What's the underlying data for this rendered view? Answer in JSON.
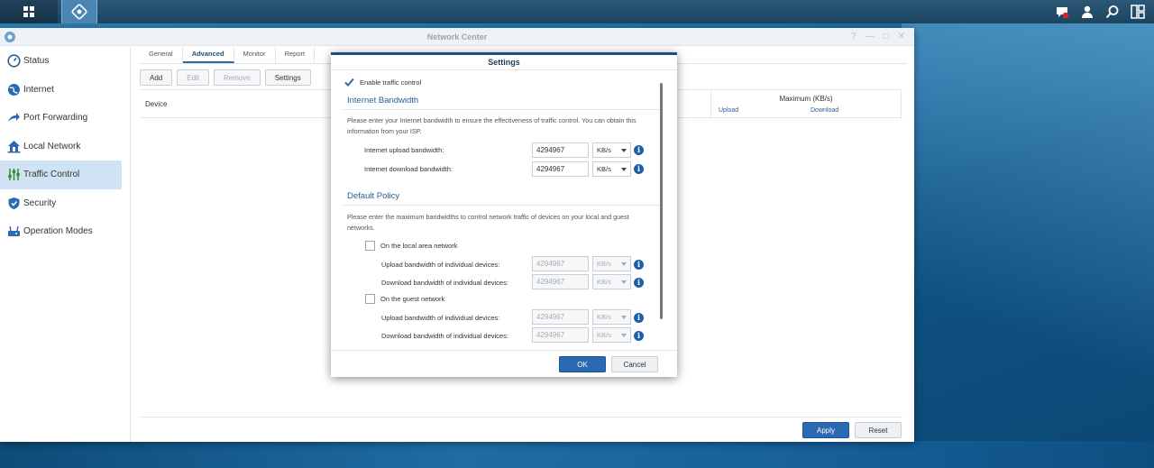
{
  "window": {
    "title": "Network Center"
  },
  "sidebar": {
    "items": [
      {
        "label": "Status",
        "icon": "status-icon"
      },
      {
        "label": "Internet",
        "icon": "globe-icon"
      },
      {
        "label": "Port Forwarding",
        "icon": "arrow-icon"
      },
      {
        "label": "Local Network",
        "icon": "home-icon"
      },
      {
        "label": "Traffic Control",
        "icon": "sliders-icon",
        "active": true
      },
      {
        "label": "Security",
        "icon": "shield-icon"
      },
      {
        "label": "Operation Modes",
        "icon": "modes-icon"
      }
    ]
  },
  "tabs": [
    "General",
    "Advanced",
    "Monitor",
    "Report"
  ],
  "toolbar": {
    "add": "Add",
    "edit": "Edit",
    "remove": "Remove",
    "settings": "Settings"
  },
  "grid": {
    "device": "Device",
    "maximum": "Maximum (KB/s)",
    "upload": "Upload",
    "download": "Download"
  },
  "footer": {
    "apply": "Apply",
    "reset": "Reset"
  },
  "modal": {
    "title": "Settings",
    "enable_label": "Enable traffic control",
    "internet": {
      "title": "Internet Bandwidth",
      "description": "Please enter your Internet bandwidth to ensure the effectiveness of traffic control. You can obtain this information from your ISP.",
      "upload_label": "Internet upload bandwidth:",
      "upload_value": "4294967",
      "upload_unit": "KB/s",
      "download_label": "Internet download bandwidth:",
      "download_value": "4294967",
      "download_unit": "KB/s"
    },
    "policy": {
      "title": "Default Policy",
      "description": "Please enter the maximum bandwidths to control network traffic of devices on your local and guest networks.",
      "lan_label": "On the local area network",
      "lan_upload_label": "Upload bandwidth of individual devices:",
      "lan_upload_value": "4294967",
      "lan_upload_unit": "KB/s",
      "lan_download_label": "Download bandwidth of individual devices:",
      "lan_download_value": "4294967",
      "lan_download_unit": "KB/s",
      "guest_label": "On the guest network",
      "guest_upload_label": "Upload bandwidth of individual devices:",
      "guest_upload_value": "4294967",
      "guest_upload_unit": "KB/s",
      "guest_download_label": "Download bandwidth of individual devices:",
      "guest_download_value": "4294967",
      "guest_download_unit": "KB/s"
    },
    "ok": "OK",
    "cancel": "Cancel"
  },
  "colors": {
    "accent": "#2b6ab1",
    "sidebar_active": "#cfe3f4",
    "section_title": "#2b5f93"
  }
}
